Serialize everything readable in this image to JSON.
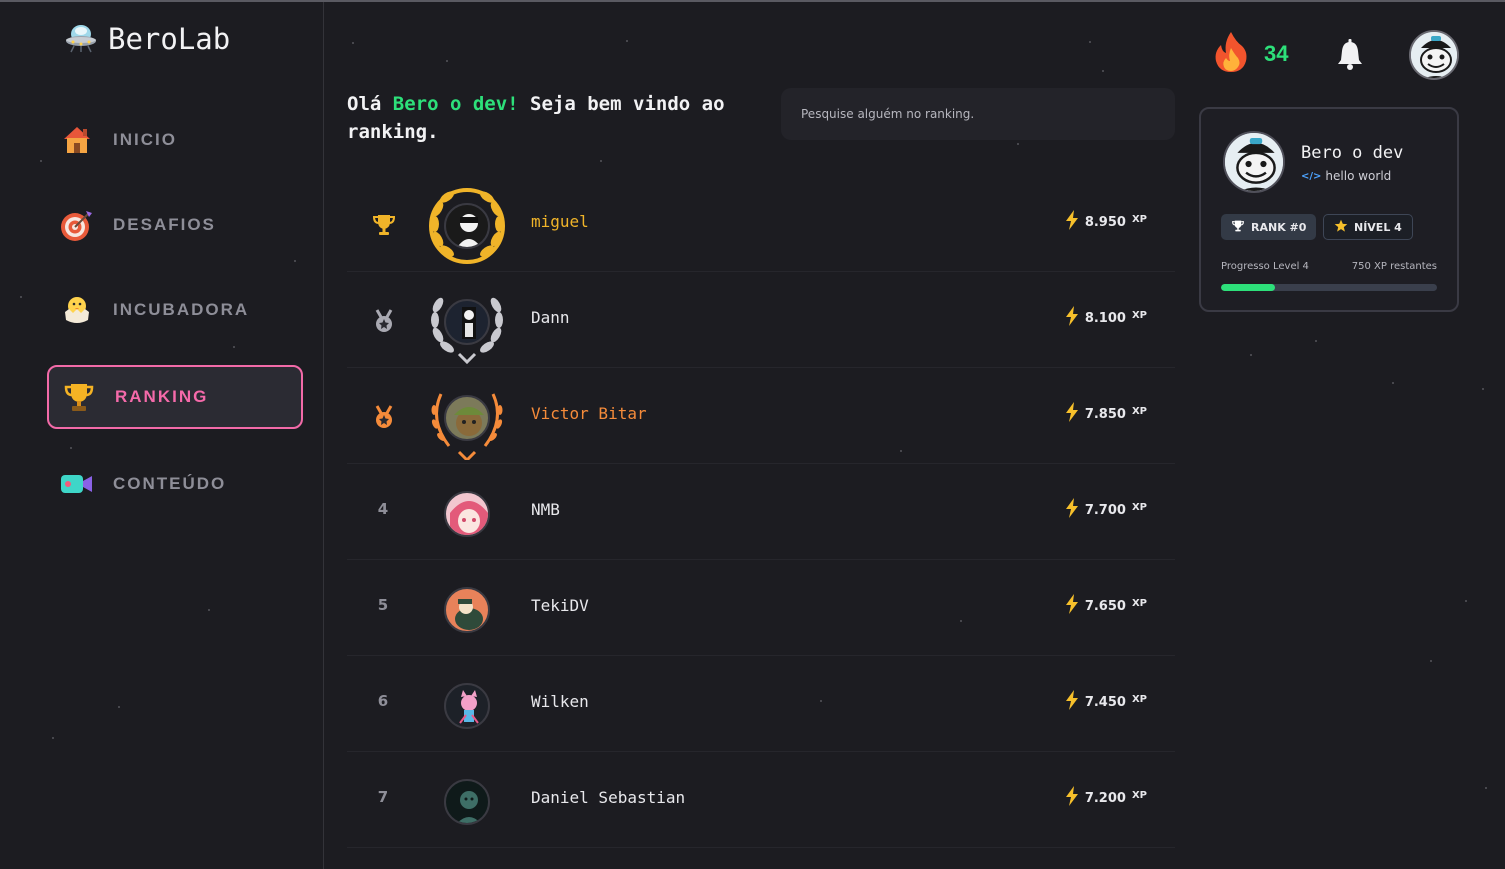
{
  "app": {
    "name": "BeroLab"
  },
  "sidebar": {
    "items": [
      {
        "label": "INICIO",
        "icon": "house-icon",
        "active": false
      },
      {
        "label": "DESAFIOS",
        "icon": "target-icon",
        "active": false
      },
      {
        "label": "INCUBADORA",
        "icon": "hatching-chick-icon",
        "active": false
      },
      {
        "label": "RANKING",
        "icon": "trophy-icon",
        "active": true
      },
      {
        "label": "CONTEÚDO",
        "icon": "video-camera-icon",
        "active": false
      }
    ]
  },
  "greeting": {
    "prefix": "Olá ",
    "name": "Bero o dev!",
    "suffix": " Seja bem vindo ao ranking."
  },
  "search": {
    "placeholder": "Pesquise alguém no ranking."
  },
  "ranking": [
    {
      "position": "1",
      "name": "miguel",
      "xp": "8.950",
      "unit": "XP",
      "medal": "gold",
      "name_color": "#f0b429"
    },
    {
      "position": "2",
      "name": "Dann",
      "xp": "8.100",
      "unit": "XP",
      "medal": "silver",
      "name_color": "#e8e8ec"
    },
    {
      "position": "3",
      "name": "Victor Bitar",
      "xp": "7.850",
      "unit": "XP",
      "medal": "bronze",
      "name_color": "#f58b3a"
    },
    {
      "position": "4",
      "name": "NMB",
      "xp": "7.700",
      "unit": "XP",
      "medal": "none",
      "name_color": "#e8e8ec"
    },
    {
      "position": "5",
      "name": "TekiDV",
      "xp": "7.650",
      "unit": "XP",
      "medal": "none",
      "name_color": "#e8e8ec"
    },
    {
      "position": "6",
      "name": "Wilken",
      "xp": "7.450",
      "unit": "XP",
      "medal": "none",
      "name_color": "#e8e8ec"
    },
    {
      "position": "7",
      "name": "Daniel Sebastian",
      "xp": "7.200",
      "unit": "XP",
      "medal": "none",
      "name_color": "#e8e8ec"
    }
  ],
  "header": {
    "streak": "34"
  },
  "profile": {
    "name": "Bero o dev",
    "bio": "hello world",
    "rank_badge": "RANK #0",
    "level_badge": "NÍVEL 4",
    "progress_label": "Progresso Level 4",
    "xp_remaining": "750 XP restantes",
    "progress": 0.25
  },
  "colors": {
    "accent_green": "#2de07a",
    "accent_pink": "#f56aaa",
    "gold": "#f0b429",
    "silver": "#c9c9cf",
    "bronze": "#f58b3a",
    "lightning": "#f7c02b",
    "background": "#1c1c21"
  }
}
